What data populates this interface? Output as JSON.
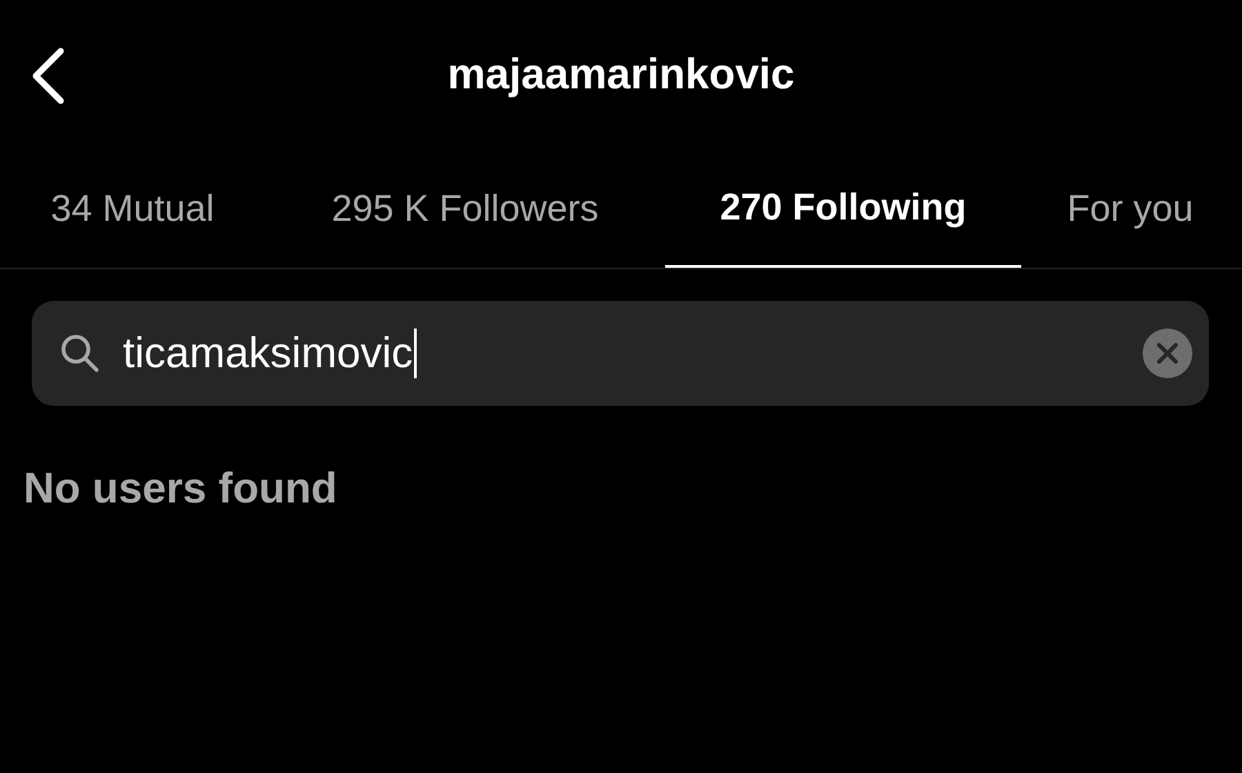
{
  "header": {
    "title": "majaamarinkovic"
  },
  "tabs": [
    {
      "label": "34 Mutual",
      "selected": false
    },
    {
      "label": "295 K Followers",
      "selected": false
    },
    {
      "label": "270 Following",
      "selected": true
    },
    {
      "label": "For you",
      "selected": false
    }
  ],
  "search": {
    "value": "ticamaksimovic"
  },
  "empty_message": "No users found"
}
